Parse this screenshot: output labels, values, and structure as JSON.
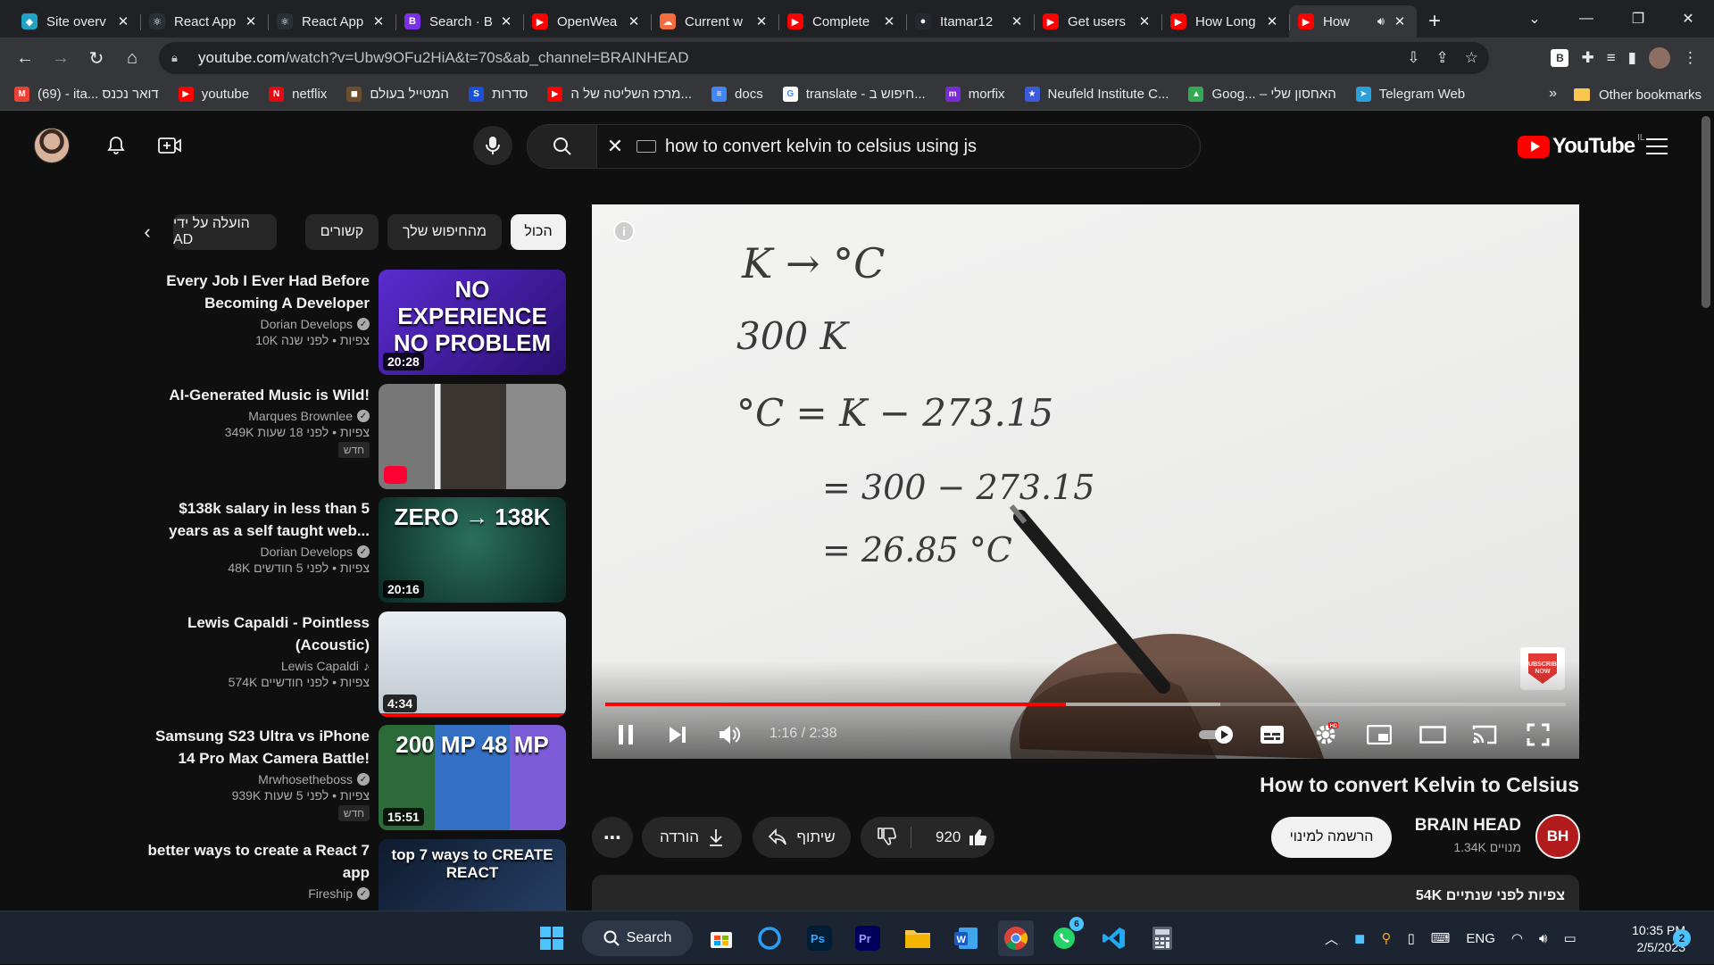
{
  "browser": {
    "tabs": [
      {
        "label": "Site overv",
        "color": "#1fa2c4",
        "glyph": "◆"
      },
      {
        "label": "React App",
        "color": "#2b2f36",
        "glyph": "⚛"
      },
      {
        "label": "React App",
        "color": "#2b2f36",
        "glyph": "⚛"
      },
      {
        "label": "Search · B",
        "color": "#7b2fe6",
        "glyph": "B"
      },
      {
        "label": "OpenWea",
        "color": "#ff0000",
        "glyph": "▶"
      },
      {
        "label": "Current w",
        "color": "#f26d3d",
        "glyph": "☁"
      },
      {
        "label": "Complete",
        "color": "#ff0000",
        "glyph": "▶"
      },
      {
        "label": "Itamar12",
        "color": "#24292f",
        "glyph": "●"
      },
      {
        "label": "Get users",
        "color": "#ff0000",
        "glyph": "▶"
      },
      {
        "label": "How Long",
        "color": "#ff0000",
        "glyph": "▶"
      },
      {
        "label": "How",
        "color": "#ff0000",
        "glyph": "▶"
      }
    ],
    "new_tab": "+",
    "url_host": "youtube.com",
    "url_path": "/watch?v=Ubw9OFu2HiA&t=70s&ab_channel=BRAINHEAD",
    "bookmarks": [
      {
        "label": "(69) - ita... דואר נכנס",
        "color": "#ea4335",
        "glyph": "M"
      },
      {
        "label": "youtube",
        "color": "#ff0000",
        "glyph": "▶"
      },
      {
        "label": "netflix",
        "color": "#e50914",
        "glyph": "N"
      },
      {
        "label": "המטייל בעולם",
        "color": "#6b4f2a",
        "glyph": "◼"
      },
      {
        "label": "סדרות",
        "color": "#1b4fd8",
        "glyph": "S"
      },
      {
        "label": "מרכז השליטה של ה...",
        "color": "#ff0000",
        "glyph": "▶"
      },
      {
        "label": "docs",
        "color": "#4285f4",
        "glyph": "≡"
      },
      {
        "label": "translate - חיפוש ב...",
        "color": "#ffffff",
        "glyph": "G"
      },
      {
        "label": "morfix",
        "color": "#7a2bd8",
        "glyph": "m"
      },
      {
        "label": "Neufeld Institute C...",
        "color": "#3b5bdb",
        "glyph": "★"
      },
      {
        "label": "Goog... – האחסון שלי",
        "color": "#34a853",
        "glyph": "▲"
      },
      {
        "label": "Telegram Web",
        "color": "#2aa1da",
        "glyph": "➤"
      }
    ],
    "bookmarks_more": "»",
    "other_bookmarks": "Other bookmarks"
  },
  "masthead": {
    "search_query": "how to convert kelvin to celsius using js",
    "logo_text": "YouTube",
    "logo_country": "IL"
  },
  "player": {
    "current_time": "1:16",
    "duration": "2:38",
    "time_separator": " / ",
    "played_fraction": 0.48,
    "buffered_fraction": 0.64,
    "subscribe_badge": "SUBSCRIBE NOW",
    "board_lines": [
      "K → °C",
      "300 K",
      "°C = K − 273.15",
      "= 300 − 273.15",
      "= 26.85 °C"
    ]
  },
  "video": {
    "title": "How to convert Kelvin to Celsius",
    "channel_name": "BRAIN HEAD",
    "channel_initials": "BH",
    "subscribers": "1.34K מנויים",
    "subscribe_label": "הרשמה למינוי",
    "likes": "920",
    "share_label": "שיתוף",
    "download_label": "הורדה",
    "more_label": "⋯",
    "desc_meta": "54K צפיות  לפני שנתיים"
  },
  "sidebar": {
    "chips": [
      "הכול",
      "מהחיפוש שלך",
      "קשורים",
      "הועלה על ידי AD"
    ],
    "items": [
      {
        "title": "Every Job I Ever Had Before Becoming A Developer",
        "channel": "Dorian Develops",
        "verified": true,
        "meta": "10K צפיות • לפני שנה",
        "duration": "20:28",
        "badge": "",
        "thumb_text": "NO EXPERIENCE NO PROBLEM"
      },
      {
        "title": "AI-Generated Music is Wild!",
        "channel": "Marques Brownlee",
        "verified": true,
        "meta": "349K צפיות • לפני 18 שעות",
        "duration": "",
        "badge": "חדש",
        "thumb_text": ""
      },
      {
        "title": "$138k salary in less than 5 years as a self taught web...",
        "channel": "Dorian Develops",
        "verified": true,
        "meta": "48K צפיות • לפני 5 חודשים",
        "duration": "20:16",
        "badge": "",
        "thumb_text": "ZERO → 138K"
      },
      {
        "title": "Lewis Capaldi - Pointless (Acoustic)",
        "channel": "Lewis Capaldi",
        "verified": false,
        "music": true,
        "meta": "574K צפיות • לפני חודשיים",
        "duration": "4:34",
        "badge": "",
        "thumb_text": ""
      },
      {
        "title": "Samsung S23 Ultra vs iPhone 14 Pro Max Camera Battle!",
        "channel": "Mrwhosetheboss",
        "verified": true,
        "meta": "939K צפיות • לפני 5 שעות",
        "duration": "15:51",
        "badge": "חדש",
        "thumb_text": "200 MP 48 MP"
      },
      {
        "title": "better ways to create a React 7 app",
        "channel": "Fireship",
        "verified": true,
        "meta": "",
        "duration": "",
        "badge": "",
        "thumb_text": "top 7 ways to CREATE REACT"
      }
    ]
  },
  "taskbar": {
    "search_label": "Search",
    "language": "ENG",
    "time": "10:35 PM",
    "date": "2/5/2023",
    "notifications": "2",
    "whatsapp_badge": "6"
  }
}
